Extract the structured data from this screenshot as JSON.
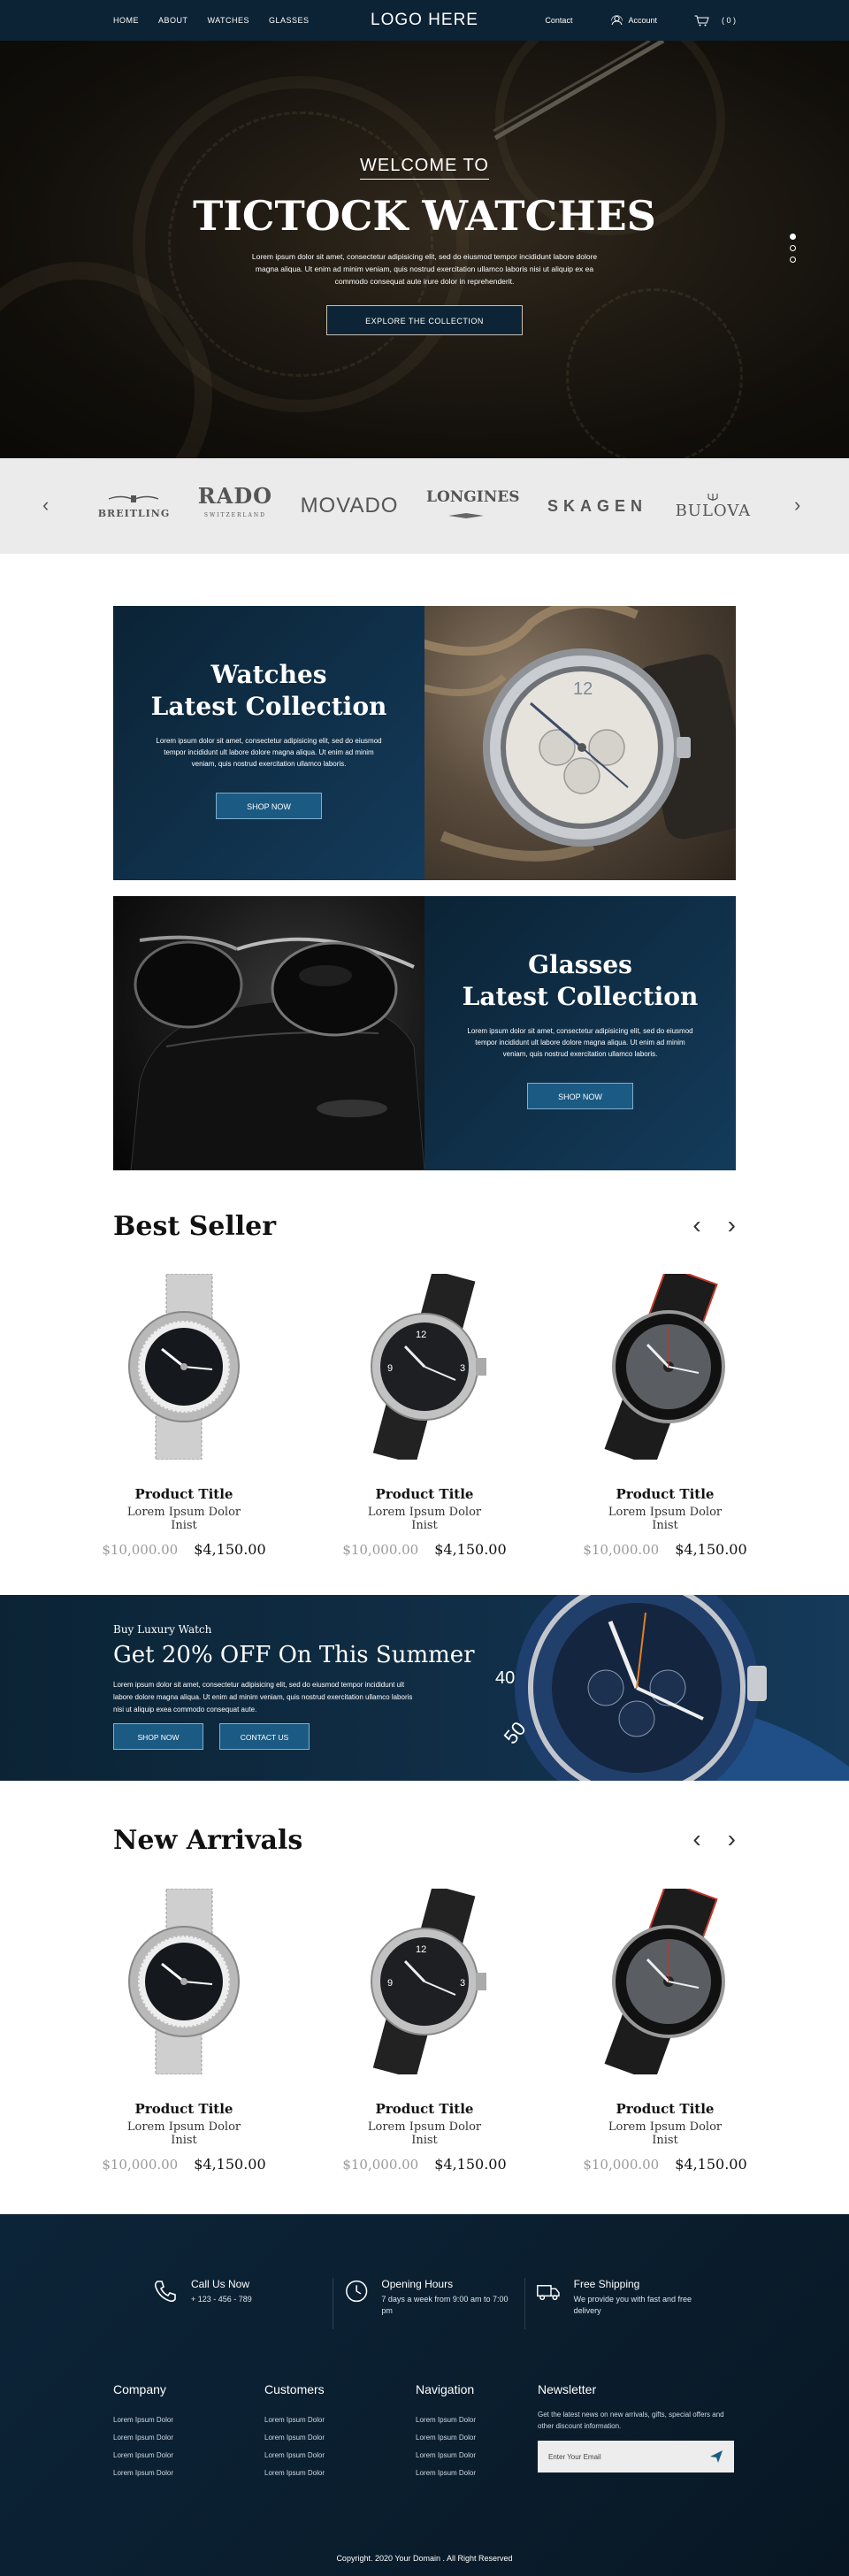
{
  "header": {
    "nav": [
      "HOME",
      "ABOUT",
      "WATCHES",
      "GLASSES"
    ],
    "logo": "LOGO HERE",
    "contact": "Contact",
    "account": "Account",
    "cart_count": "( 0 )"
  },
  "hero": {
    "welcome": "WELCOME TO",
    "title": "TICTOCK WATCHES",
    "text": "Lorem ipsum dolor sit amet, consectetur adipisicing elit, sed do eiusmod tempor incididunt labore dolore magna aliqua. Ut enim ad minim veniam, quis nostrud exercitation ullamco laboris nisi ut aliquip ex ea commodo consequat aute irure dolor in reprehenderit.",
    "button": "EXPLORE THE COLLECTION"
  },
  "brands": [
    "BREITLING",
    "RADO",
    "SWITZERLAND",
    "MOVADO",
    "LONGINES",
    "SKAGEN",
    "BULOVA"
  ],
  "collections": [
    {
      "title_line1": "Watches",
      "title_line2": "Latest Collection",
      "text": "Lorem ipsum dolor sit amet, consectetur adipisicing elit, sed do eiusmod tempor incididunt ult labore dolore magna aliqua. Ut enim ad minim veniam, quis nostrud exercitation ullamco laboris.",
      "button": "SHOP NOW"
    },
    {
      "title_line1": "Glasses",
      "title_line2": "Latest Collection",
      "text": "Lorem ipsum dolor sit amet, consectetur adipisicing elit, sed do eiusmod tempor incididunt ult labore dolore magna aliqua. Ut enim ad minim veniam, quis nostrud exercitation ullamco laboris.",
      "button": "SHOP NOW"
    }
  ],
  "best_seller": {
    "title": "Best Seller",
    "products": [
      {
        "title": "Product Title",
        "subtitle": "Lorem Ipsum Dolor Inist",
        "old_price": "$10,000.00",
        "price": "$4,150.00"
      },
      {
        "title": "Product Title",
        "subtitle": "Lorem Ipsum Dolor Inist",
        "old_price": "$10,000.00",
        "price": "$4,150.00"
      },
      {
        "title": "Product Title",
        "subtitle": "Lorem Ipsum Dolor Inist",
        "old_price": "$10,000.00",
        "price": "$4,150.00"
      }
    ]
  },
  "promo": {
    "small": "Buy Luxury Watch",
    "title": "Get 20% OFF On This Summer",
    "text": "Lorem ipsum dolor sit amet, consectetur adipisicing elit, sed do eiusmod tempor incididunt ult labore dolore magna aliqua. Ut enim ad minim veniam, quis nostrud exercitation ullamco laboris nisi ut aliquip exea commodo consequat aute.",
    "button1": "SHOP NOW",
    "button2": "CONTACT US"
  },
  "new_arrivals": {
    "title": "New Arrivals",
    "products": [
      {
        "title": "Product Title",
        "subtitle": "Lorem Ipsum Dolor Inist",
        "old_price": "$10,000.00",
        "price": "$4,150.00"
      },
      {
        "title": "Product Title",
        "subtitle": "Lorem Ipsum Dolor Inist",
        "old_price": "$10,000.00",
        "price": "$4,150.00"
      },
      {
        "title": "Product Title",
        "subtitle": "Lorem Ipsum Dolor Inist",
        "old_price": "$10,000.00",
        "price": "$4,150.00"
      }
    ]
  },
  "footer": {
    "features": [
      {
        "title": "Call Us Now",
        "text": "+ 123 - 456 - 789"
      },
      {
        "title": "Opening Hours",
        "text": "7 days a week from 9:00 am to 7:00 pm"
      },
      {
        "title": "Free Shipping",
        "text": "We provide you with fast and free delivery"
      }
    ],
    "company": {
      "title": "Company",
      "links": [
        "Lorem Ipsum Dolor",
        "Lorem Ipsum Dolor",
        "Lorem Ipsum Dolor",
        "Lorem Ipsum Dolor"
      ]
    },
    "customers": {
      "title": "Customers",
      "links": [
        "Lorem Ipsum Dolor",
        "Lorem Ipsum Dolor",
        "Lorem Ipsum Dolor",
        "Lorem Ipsum Dolor"
      ]
    },
    "navigation": {
      "title": "Navigation",
      "links": [
        "Lorem Ipsum Dolor",
        "Lorem Ipsum Dolor",
        "Lorem Ipsum Dolor",
        "Lorem Ipsum Dolor"
      ]
    },
    "newsletter": {
      "title": "Newsletter",
      "text": "Get the latest news on new arrivals, gifts, special offers and other discount information.",
      "placeholder": "Enter Your Email"
    },
    "copyright": "Copyright. 2020 Your Domain . All Right Reserved"
  },
  "colors": {
    "navy": "#0c2235",
    "accent": "#1b5a83",
    "brand_strip": "#ebebeb"
  }
}
